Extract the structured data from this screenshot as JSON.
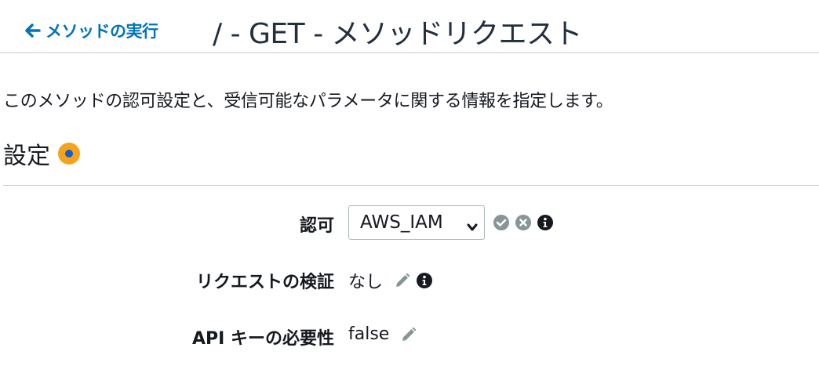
{
  "header": {
    "back_link_label": "メソッドの実行",
    "title": "/ - GET - メソッドリクエスト"
  },
  "description": "このメソッドの認可設定と、受信可能なパラメータに関する情報を指定します。",
  "settings": {
    "title": "設定",
    "rows": [
      {
        "label": "認可",
        "value": "AWS_IAM"
      },
      {
        "label": "リクエストの検証",
        "value": "なし"
      },
      {
        "label": "API キーの必要性",
        "value": "false"
      }
    ]
  },
  "colors": {
    "link": "#0073bb",
    "status_outer": "#f7a21b",
    "status_inner": "#1060c8",
    "icon_gray": "#879596"
  },
  "icons": {
    "back": "arrow-left-icon",
    "status": "status-dot-icon",
    "confirm": "check-circle-icon",
    "cancel": "x-circle-icon",
    "info": "info-circle-icon",
    "edit": "pencil-icon",
    "dropdown": "chevron-down-icon"
  }
}
